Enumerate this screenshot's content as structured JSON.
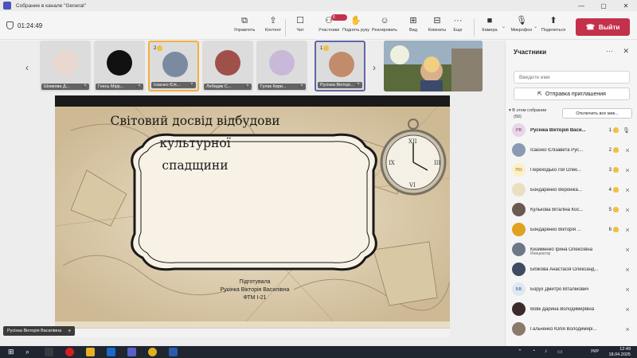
{
  "window": {
    "title": "Собрание в канале \"General\"",
    "controls": [
      "—",
      "▢",
      "✕"
    ]
  },
  "toolbar": {
    "timer": "01:24:49",
    "buttons": [
      {
        "label": "Управлять",
        "icon": "control-icon",
        "glyph": "⧉"
      },
      {
        "label": "Контент",
        "icon": "share-icon",
        "glyph": "⇪"
      },
      {
        "label": "Чат",
        "icon": "chat-icon",
        "glyph": "☐"
      },
      {
        "label": "Участники",
        "icon": "people-icon",
        "glyph": "⚇",
        "badge": "6"
      },
      {
        "label": "Поднять руку",
        "icon": "hand-icon",
        "glyph": "✋"
      },
      {
        "label": "Реагировать",
        "icon": "emoji-icon",
        "glyph": "☺"
      },
      {
        "label": "Вид",
        "icon": "view-icon",
        "glyph": "⊞"
      },
      {
        "label": "Комнаты",
        "icon": "rooms-icon",
        "glyph": "⊟"
      },
      {
        "label": "Еще",
        "icon": "more-icon",
        "glyph": "···"
      },
      {
        "label": "Камера",
        "icon": "camera-icon",
        "glyph": "■"
      },
      {
        "label": "Микрофон",
        "icon": "mic-icon",
        "glyph": "🎙"
      },
      {
        "label": "Поделиться",
        "icon": "share-screen-icon",
        "glyph": "⬆"
      }
    ],
    "leave_label": "Выйти"
  },
  "tiles": [
    {
      "name": "Шовкова Д...",
      "avatar_color": "#e8d8d0",
      "rank": ""
    },
    {
      "name": "Гнесь Мірр...",
      "avatar_color": "#111111",
      "rank": ""
    },
    {
      "name": "Ісаєнко Єлі...",
      "avatar_color": "#7a8aa0",
      "rank": "2"
    },
    {
      "name": "Лебедик С...",
      "avatar_color": "#a0504a",
      "rank": ""
    },
    {
      "name": "Гулак Кири...",
      "avatar_color": "#c9b8d8",
      "rank": ""
    },
    {
      "name": "Русінка Вікторі...",
      "avatar_color": "#c28b6a",
      "rank": "1"
    }
  ],
  "slide": {
    "title_line1": "Світовий досвід відбудови культурної",
    "title_line2": "спадщини",
    "credit_line1": "Підготувала",
    "credit_line2": "Русінка Вікторія Василівна",
    "credit_line3": "ФТМ І-21"
  },
  "self_label": "Русінка Вікторія Василівна",
  "panel": {
    "title": "Участники",
    "search_placeholder": "Введите имя",
    "invite_label": "Отправка приглашения",
    "in_meeting": "В этом собрании",
    "in_meeting_count": "(50)",
    "mute_all": "Отключить все мик...",
    "participants": [
      {
        "initials": "РВ",
        "name": "Русінка Вікторія Васи...",
        "bold": true,
        "rank": "1",
        "av": "#e9d5e8",
        "fg": "#7b3f7a"
      },
      {
        "initials": "",
        "name": "Ісаєнко Єлізавета Рус...",
        "rank": "2",
        "av": "#8a9ab0",
        "fg": "#fff"
      },
      {
        "initials": "ПО",
        "name": "Переходько Лія Олек...",
        "rank": "3",
        "av": "#fdf0c8",
        "fg": "#8a6a00"
      },
      {
        "initials": "",
        "name": "Бондаренко Вероніка...",
        "rank": "4",
        "av": "#e8e0c0",
        "fg": "#fff"
      },
      {
        "initials": "",
        "name": "Кулькова Віталіна Кос...",
        "rank": "5",
        "av": "#6a5a50",
        "fg": "#fff"
      },
      {
        "initials": "",
        "name": "Бондаренко Вікторія ...",
        "rank": "6",
        "av": "#e0a020",
        "fg": "#fff"
      },
      {
        "initials": "",
        "name": "Кизименко Ірина Олексіївна",
        "sub": "Инициатор",
        "rank": "",
        "av": "#707888",
        "fg": "#fff"
      },
      {
        "initials": "",
        "name": "Бібікова Анастасія Олександ...",
        "rank": "",
        "av": "#404a60",
        "fg": "#fff"
      },
      {
        "initials": "БВ",
        "name": "Борух Дмитро Віталійович",
        "rank": "",
        "av": "#dde8f0",
        "fg": "#2d5a80"
      },
      {
        "initials": "",
        "name": "Вовк Дарина Володимирівна",
        "rank": "",
        "av": "#3a2a2a",
        "fg": "#fff"
      },
      {
        "initials": "",
        "name": "Гальченко Юлія Володимирі...",
        "rank": "",
        "av": "#8a7a6a",
        "fg": "#fff"
      }
    ]
  },
  "taskbar": {
    "lang": "УКР",
    "time": "12:49",
    "date": "18.04.2025"
  }
}
